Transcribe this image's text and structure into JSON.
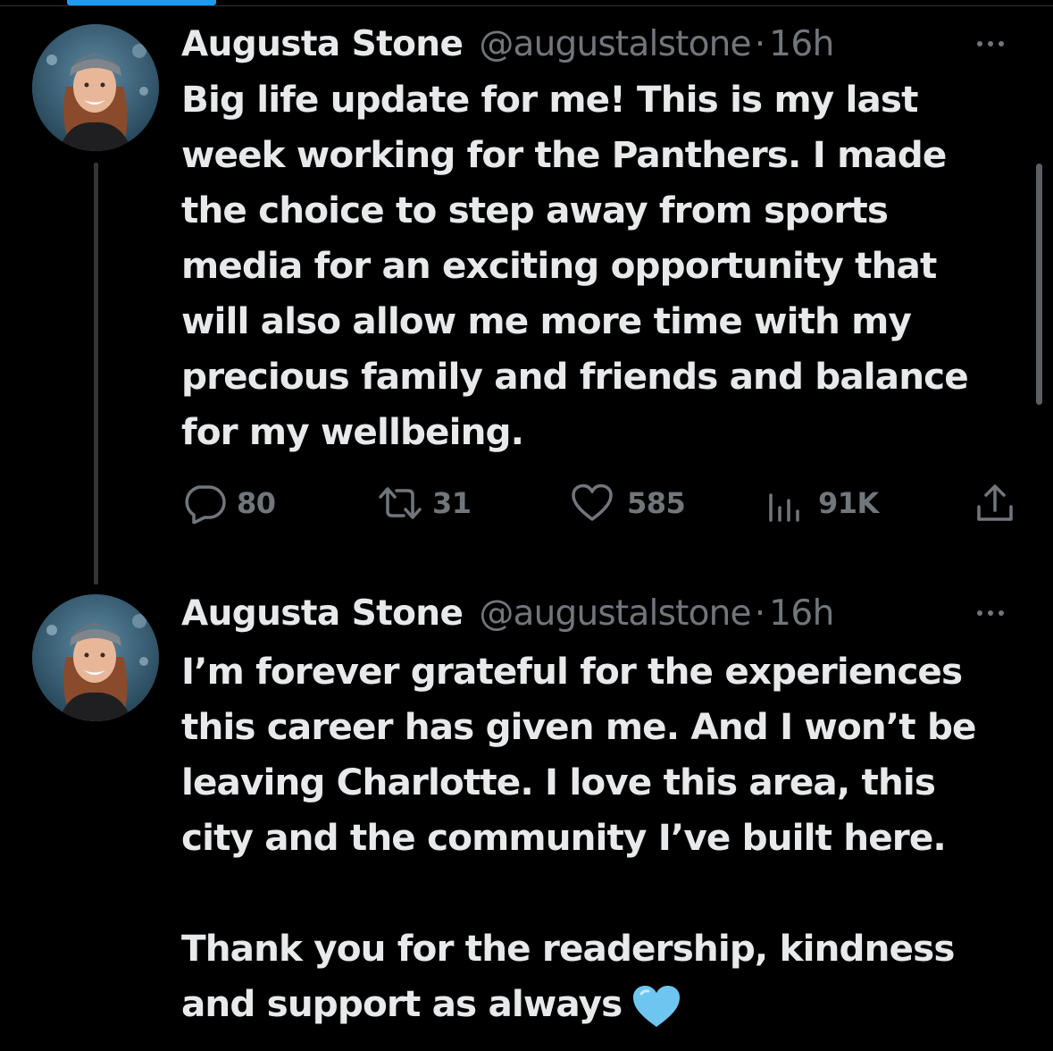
{
  "theme": {
    "background": "#000000",
    "primary_text": "#e7e9ea",
    "secondary_text": "#71767b",
    "accent": "#1d9bf0",
    "heart_emoji_color": "#6ec6f0"
  },
  "tweets": [
    {
      "author": {
        "name": "Augusta Stone",
        "handle": "@augustalstone",
        "avatar_icon": "profile-photo"
      },
      "separator": "·",
      "time": "16h",
      "more_icon": "more-horizontal-icon",
      "text": "Big life update for me! This is my last\nweek working for the Panthers. I made\nthe choice to step away from sports\nmedia for an exciting opportunity that\nwill also allow me more time with my\nprecious family and friends and balance\nfor my wellbeing.",
      "actions": {
        "replies": {
          "icon": "reply-icon",
          "count": "80"
        },
        "retweets": {
          "icon": "retweet-icon",
          "count": "31"
        },
        "likes": {
          "icon": "heart-icon",
          "count": "585"
        },
        "views": {
          "icon": "views-icon",
          "count": "91K"
        },
        "share": {
          "icon": "share-icon"
        }
      }
    },
    {
      "author": {
        "name": "Augusta Stone",
        "handle": "@augustalstone",
        "avatar_icon": "profile-photo"
      },
      "separator": "·",
      "time": "16h",
      "more_icon": "more-horizontal-icon",
      "text": "I’m forever grateful for the experiences\nthis career has given me. And I won’t be\nleaving Charlotte. I love this area, this\ncity and the community I’ve built here.\n\nThank you for the readership, kindness\nand support as always",
      "emoji": "light-blue-heart-emoji"
    }
  ]
}
